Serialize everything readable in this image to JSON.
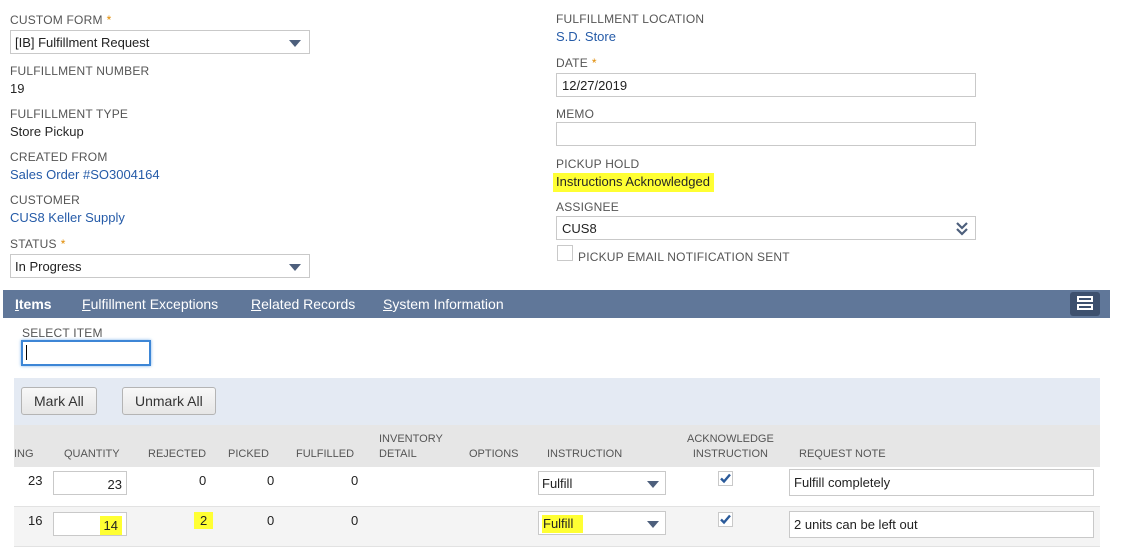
{
  "form": {
    "custom_form_label": "CUSTOM FORM",
    "custom_form_value": "[IB] Fulfillment Request",
    "fulfillment_number_label": "FULFILLMENT NUMBER",
    "fulfillment_number_value": "19",
    "fulfillment_type_label": "FULFILLMENT TYPE",
    "fulfillment_type_value": "Store Pickup",
    "created_from_label": "CREATED FROM",
    "created_from_value": "Sales Order #SO3004164",
    "customer_label": "CUSTOMER",
    "customer_value": "CUS8 Keller Supply",
    "status_label": "STATUS",
    "status_value": "In Progress",
    "fulfillment_location_label": "FULFILLMENT LOCATION",
    "fulfillment_location_value": "S.D. Store",
    "date_label": "DATE",
    "date_value": "12/27/2019",
    "memo_label": "MEMO",
    "memo_value": "",
    "pickup_hold_label": "PICKUP HOLD",
    "pickup_hold_value": "Instructions Acknowledged",
    "assignee_label": "ASSIGNEE",
    "assignee_value": "CUS8",
    "pickup_email_label": "PICKUP EMAIL NOTIFICATION SENT",
    "required_mark": "*"
  },
  "tabs": [
    {
      "first": "I",
      "rest": "tems"
    },
    {
      "first": "F",
      "rest": "ulfillment Exceptions"
    },
    {
      "first": "R",
      "rest": "elated Records"
    },
    {
      "first": "S",
      "rest": "ystem Information"
    }
  ],
  "items": {
    "select_item_label": "SELECT ITEM",
    "select_item_value": "",
    "mark_all": "Mark All",
    "unmark_all": "Unmark All",
    "columns": {
      "ing": "ING",
      "quantity": "QUANTITY",
      "rejected": "REJECTED",
      "picked": "PICKED",
      "fulfilled": "FULFILLED",
      "inventory_1": "INVENTORY",
      "inventory_2": "DETAIL",
      "options": "OPTIONS",
      "instruction": "INSTRUCTION",
      "ack_1": "ACKNOWLEDGE",
      "ack_2": "INSTRUCTION",
      "request_note": "REQUEST NOTE"
    },
    "rows": [
      {
        "ing": "23",
        "quantity": "23",
        "rejected": "0",
        "picked": "0",
        "fulfilled": "0",
        "instruction": "Fulfill",
        "acknowledged": true,
        "request_note": "Fulfill completely"
      },
      {
        "ing": "16",
        "quantity": "14",
        "rejected": "2",
        "picked": "0",
        "fulfilled": "0",
        "instruction": "Fulfill",
        "acknowledged": true,
        "request_note": "2 units can be left out"
      }
    ]
  },
  "colors": {
    "tabbar": "#607799",
    "link": "#255ba8",
    "highlight": "#ffff33",
    "required": "#e08a00"
  }
}
